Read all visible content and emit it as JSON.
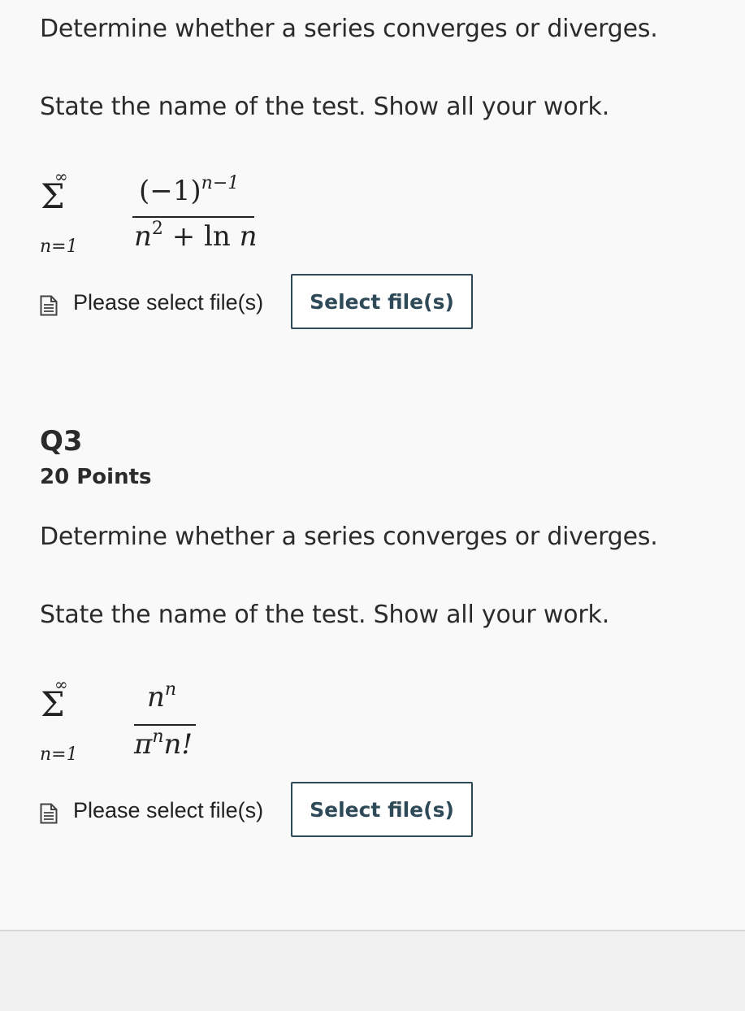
{
  "q2": {
    "prompt_line1": "Determine whether a series converges or diverges.",
    "prompt_line2": "State the name of the test. Show all your work.",
    "formula": {
      "upper": "∞",
      "sigma": "Σ",
      "lower": "n=1",
      "numerator": "(−1)",
      "numerator_exp": "n−1",
      "denominator": "n",
      "denominator_exp": "2",
      "denominator_rest": " + ln ",
      "denominator_var": "n"
    },
    "upload_label": "Please select file(s)",
    "select_button": "Select file(s)"
  },
  "q3": {
    "title": "Q3",
    "points": "20 Points",
    "prompt_line1": "Determine whether a series converges or diverges.",
    "prompt_line2": "State the name of the test. Show all your work.",
    "formula": {
      "upper": "∞",
      "sigma": "Σ",
      "lower": "n=1",
      "numerator": "n",
      "numerator_exp": "n",
      "denominator": "π",
      "denominator_exp": "n",
      "denominator_rest": "n!"
    },
    "upload_label": "Please select file(s)",
    "select_button": "Select file(s)"
  },
  "icons": {
    "file": "file-document-icon"
  }
}
